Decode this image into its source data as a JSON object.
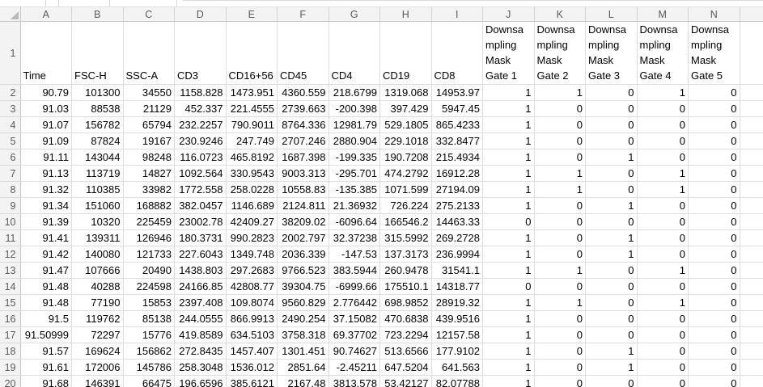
{
  "colors": {
    "header_bg": "#f3f3f3",
    "header_text": "#5a5a5a",
    "gridline": "#dcdcdc",
    "header_border": "#c6c6c6",
    "cell_text": "#000000",
    "select_all_triangle": "#b9b9b9"
  },
  "grid": {
    "column_letters": [
      "A",
      "B",
      "C",
      "D",
      "E",
      "F",
      "G",
      "H",
      "I",
      "J",
      "K",
      "L",
      "M",
      "N"
    ],
    "field_row_number": "1",
    "field_headers": [
      "Time",
      "FSC-H",
      "SSC-A",
      "CD3",
      "CD16+56",
      "CD45",
      "CD4",
      "CD19",
      "CD8",
      "Downsa\nmpling\nMask\nGate 1",
      "Downsa\nmpling\nMask\nGate 2",
      "Downsa\nmpling\nMask\nGate 3",
      "Downsa\nmpling\nMask\nGate 4",
      "Downsa\nmpling\nMask\nGate 5"
    ],
    "rows": [
      {
        "n": "2",
        "cells": [
          "90.79",
          "101300",
          "34550",
          "1158.828",
          "1473.951",
          "4360.559",
          "218.6799",
          "1319.068",
          "14953.97",
          "1",
          "1",
          "0",
          "1",
          "0"
        ]
      },
      {
        "n": "3",
        "cells": [
          "91.03",
          "88538",
          "21129",
          "452.337",
          "221.4555",
          "2739.663",
          "-200.398",
          "397.429",
          "5947.45",
          "1",
          "0",
          "0",
          "0",
          "0"
        ]
      },
      {
        "n": "4",
        "cells": [
          "91.07",
          "156782",
          "65794",
          "232.2257",
          "790.9011",
          "8764.336",
          "12981.79",
          "529.1805",
          "865.4233",
          "1",
          "0",
          "0",
          "0",
          "0"
        ]
      },
      {
        "n": "5",
        "cells": [
          "91.09",
          "87824",
          "19167",
          "230.9246",
          "247.749",
          "2707.246",
          "2880.904",
          "229.1018",
          "332.8477",
          "1",
          "0",
          "0",
          "0",
          "0"
        ]
      },
      {
        "n": "6",
        "cells": [
          "91.11",
          "143044",
          "98248",
          "116.0723",
          "465.8192",
          "1687.398",
          "-199.335",
          "190.7208",
          "215.4934",
          "1",
          "0",
          "1",
          "0",
          "0"
        ]
      },
      {
        "n": "7",
        "cells": [
          "91.13",
          "113719",
          "14827",
          "1092.564",
          "330.9543",
          "9003.313",
          "-295.701",
          "474.2792",
          "16912.28",
          "1",
          "1",
          "0",
          "1",
          "0"
        ]
      },
      {
        "n": "8",
        "cells": [
          "91.32",
          "110385",
          "33982",
          "1772.558",
          "258.0228",
          "10558.83",
          "-135.385",
          "1071.599",
          "27194.09",
          "1",
          "1",
          "0",
          "1",
          "0"
        ]
      },
      {
        "n": "9",
        "cells": [
          "91.34",
          "151060",
          "168882",
          "382.0457",
          "1146.689",
          "2124.811",
          "21.36932",
          "726.224",
          "275.2133",
          "1",
          "0",
          "1",
          "0",
          "0"
        ]
      },
      {
        "n": "10",
        "cells": [
          "91.39",
          "10320",
          "225459",
          "23002.78",
          "42409.27",
          "38209.02",
          "-6096.64",
          "166546.2",
          "14463.33",
          "0",
          "0",
          "0",
          "0",
          "0"
        ]
      },
      {
        "n": "11",
        "cells": [
          "91.41",
          "139311",
          "126946",
          "180.3731",
          "990.2823",
          "2002.797",
          "32.37238",
          "315.5992",
          "269.2728",
          "1",
          "0",
          "1",
          "0",
          "0"
        ]
      },
      {
        "n": "12",
        "cells": [
          "91.42",
          "140080",
          "121733",
          "227.6043",
          "1349.748",
          "2036.339",
          "-147.53",
          "137.3173",
          "236.9994",
          "1",
          "0",
          "1",
          "0",
          "0"
        ]
      },
      {
        "n": "13",
        "cells": [
          "91.47",
          "107666",
          "20490",
          "1438.803",
          "297.2683",
          "9766.523",
          "383.5944",
          "260.9478",
          "31541.1",
          "1",
          "1",
          "0",
          "1",
          "0"
        ]
      },
      {
        "n": "14",
        "cells": [
          "91.48",
          "40288",
          "224598",
          "24166.85",
          "42808.77",
          "39304.75",
          "-6999.66",
          "175510.1",
          "14318.77",
          "0",
          "0",
          "0",
          "0",
          "0"
        ]
      },
      {
        "n": "15",
        "cells": [
          "91.48",
          "77190",
          "15853",
          "2397.408",
          "109.8074",
          "9560.829",
          "2.776442",
          "698.9852",
          "28919.32",
          "1",
          "1",
          "0",
          "1",
          "0"
        ]
      },
      {
        "n": "16",
        "cells": [
          "91.5",
          "119762",
          "85138",
          "244.0555",
          "866.9913",
          "2490.254",
          "37.15082",
          "470.6838",
          "439.9516",
          "1",
          "0",
          "0",
          "0",
          "0"
        ]
      },
      {
        "n": "17",
        "cells": [
          "91.50999",
          "72297",
          "15776",
          "419.8589",
          "634.5103",
          "3758.318",
          "69.37702",
          "723.2294",
          "12157.58",
          "1",
          "0",
          "0",
          "0",
          "0"
        ]
      },
      {
        "n": "18",
        "cells": [
          "91.57",
          "169624",
          "156862",
          "272.8435",
          "1457.407",
          "1301.451",
          "90.74627",
          "513.6566",
          "177.9102",
          "1",
          "0",
          "1",
          "0",
          "0"
        ]
      },
      {
        "n": "19",
        "cells": [
          "91.61",
          "172006",
          "145786",
          "258.3048",
          "1536.012",
          "2851.64",
          "-2.45211",
          "647.5204",
          "641.563",
          "1",
          "0",
          "1",
          "0",
          "0"
        ]
      },
      {
        "n": "20",
        "cells": [
          "91.68",
          "146391",
          "66475",
          "196.6596",
          "385.6121",
          "2167.48",
          "3813.578",
          "53.42127",
          "82.07788",
          "1",
          "0",
          "0",
          "0",
          "0"
        ]
      }
    ]
  }
}
